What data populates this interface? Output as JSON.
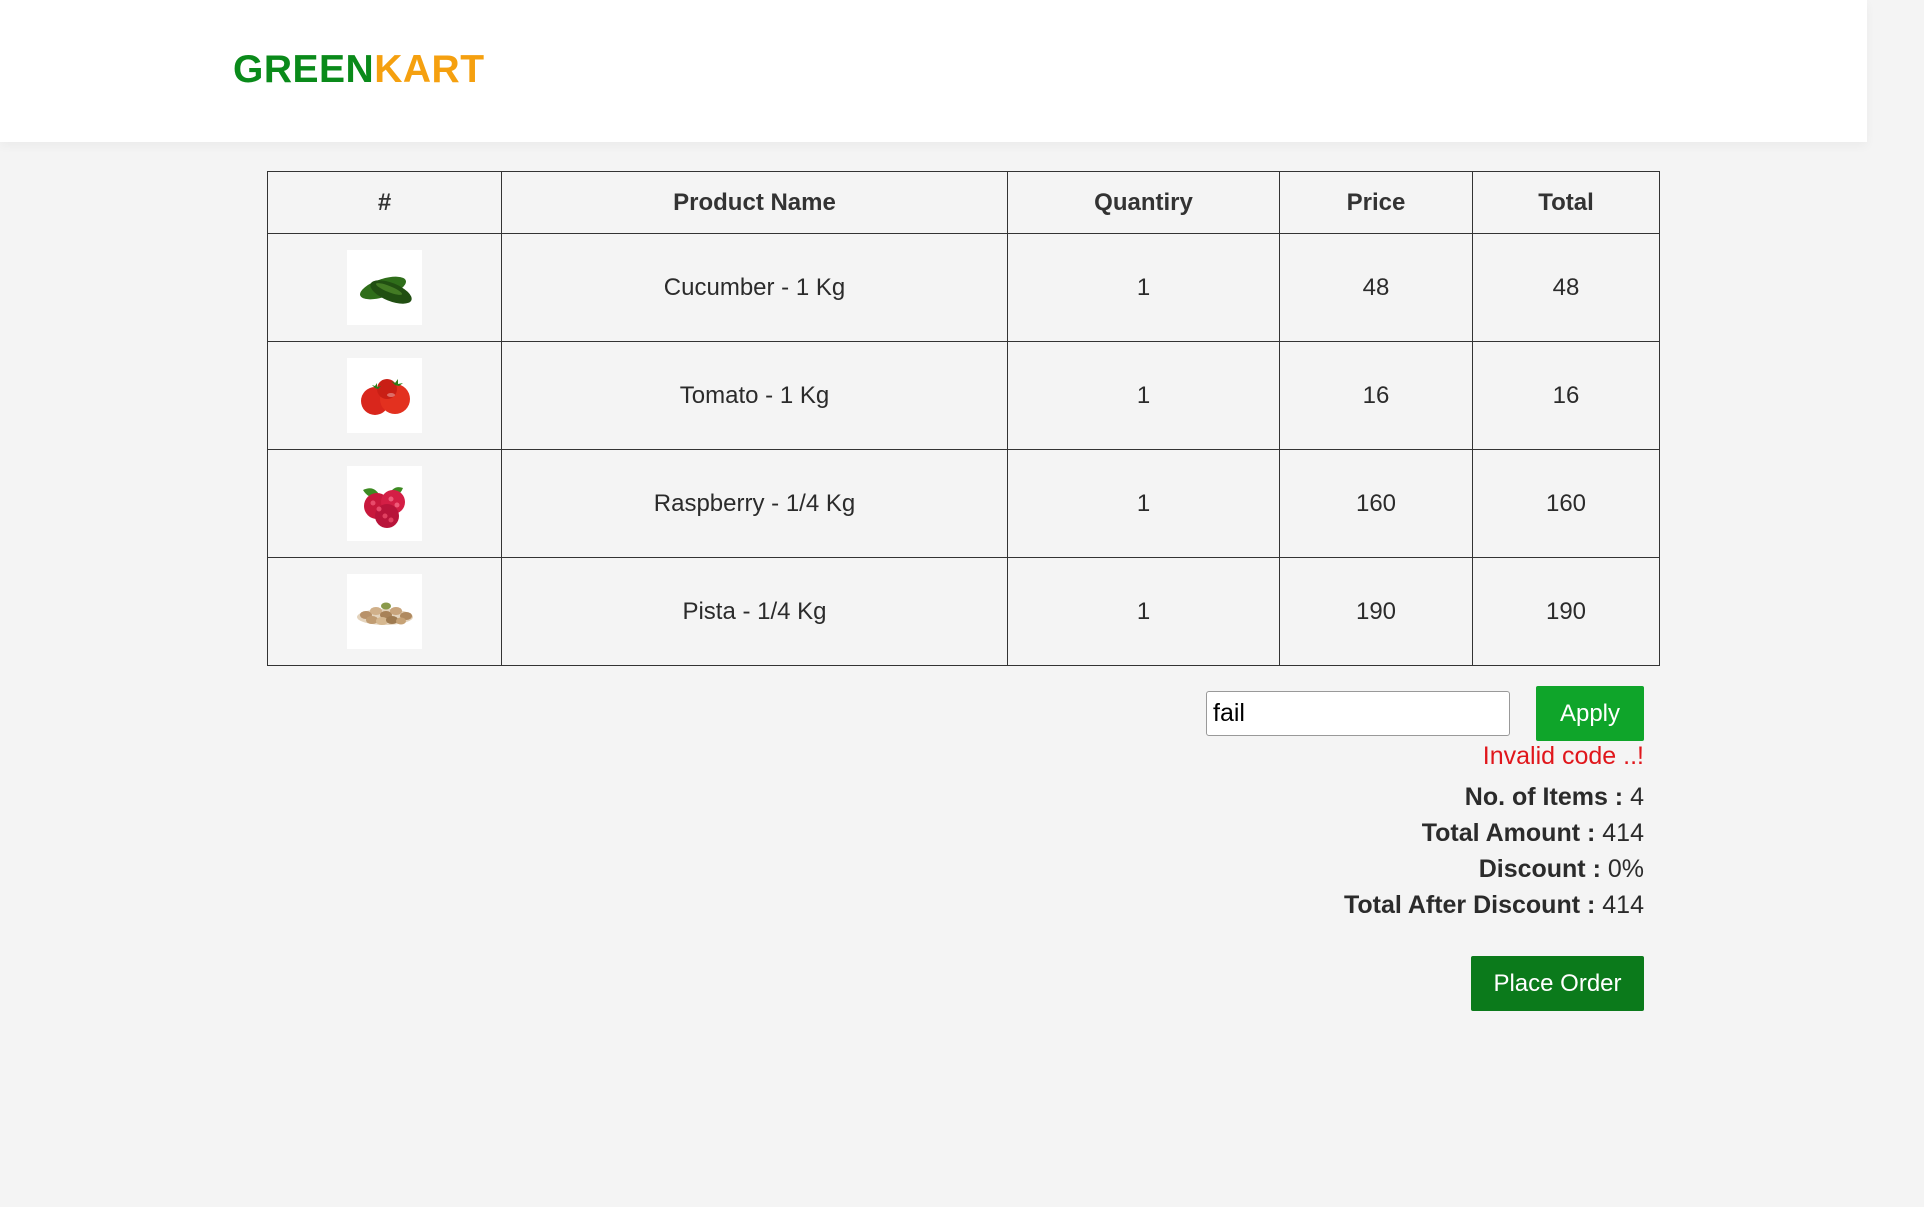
{
  "logo": {
    "green_part": "GREEN",
    "kart_part": "KART"
  },
  "table": {
    "headers": [
      "#",
      "Product Name",
      "Quantiry",
      "Price",
      "Total"
    ],
    "rows": [
      {
        "image": "cucumber-image",
        "name": "Cucumber - 1 Kg",
        "quantity": "1",
        "price": "48",
        "total": "48"
      },
      {
        "image": "tomato-image",
        "name": "Tomato - 1 Kg",
        "quantity": "1",
        "price": "16",
        "total": "16"
      },
      {
        "image": "raspberry-image",
        "name": "Raspberry - 1/4 Kg",
        "quantity": "1",
        "price": "160",
        "total": "160"
      },
      {
        "image": "pista-image",
        "name": "Pista - 1/4 Kg",
        "quantity": "1",
        "price": "190",
        "total": "190"
      }
    ]
  },
  "promo": {
    "code_value": "fail",
    "apply_label": "Apply",
    "info": "Invalid code ..!"
  },
  "summary": {
    "items_label": "No. of Items :",
    "items_value": "4",
    "amount_label": "Total Amount :",
    "amount_value": "414",
    "discount_label": "Discount :",
    "discount_value": "0%",
    "after_label": "Total After Discount :",
    "after_value": "414"
  },
  "place_order_label": "Place Order",
  "colors": {
    "brand_green": "#0a8a1a",
    "brand_orange": "#f5a00f",
    "apply_button": "#0fa52a",
    "place_order_button": "#0b7a1b",
    "error_text": "#e0161b"
  }
}
